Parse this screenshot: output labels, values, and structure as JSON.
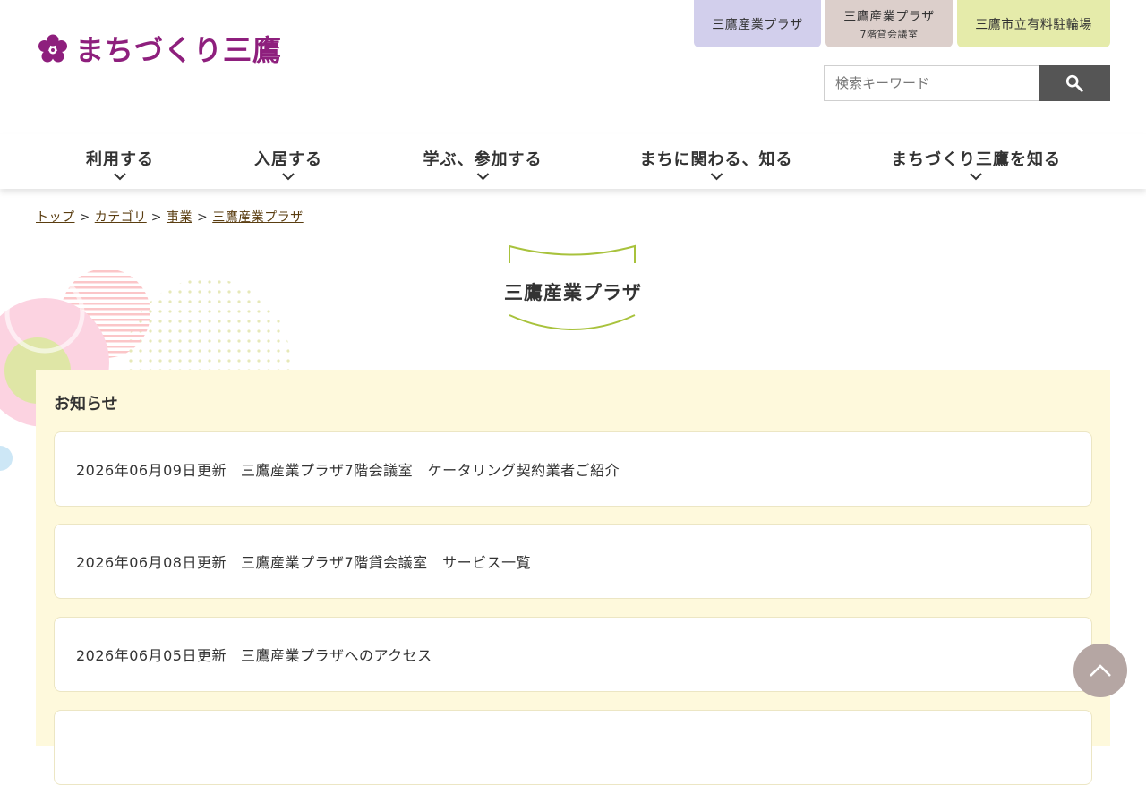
{
  "header": {
    "logo_text": "まちづくり三鷹",
    "top_tabs": [
      {
        "label": "三鷹産業プラザ",
        "sub": "",
        "color": "#d2cfec"
      },
      {
        "label": "三鷹産業プラザ",
        "sub": "7階貸会議室",
        "color": "#dccfcb"
      },
      {
        "label": "三鷹市立有料駐輪場",
        "sub": "",
        "color": "#e5ebaa"
      }
    ],
    "search": {
      "placeholder": "検索キーワード",
      "icon": "search-icon"
    }
  },
  "nav": {
    "items": [
      {
        "label": "利用する"
      },
      {
        "label": "入居する"
      },
      {
        "label": "学ぶ、参加する"
      },
      {
        "label": "まちに関わる、知る"
      },
      {
        "label": "まちづくり三鷹を知る"
      }
    ]
  },
  "breadcrumb": {
    "items": [
      "トップ",
      "カテゴリ",
      "事業",
      "三鷹産業プラザ"
    ],
    "separator": ">"
  },
  "page_title": "三鷹産業プラザ",
  "news": {
    "heading": "お知らせ",
    "items": [
      {
        "date": "2026年06月09日更新",
        "title": "三鷹産業プラザ7階会議室　ケータリング契約業者ご紹介"
      },
      {
        "date": "2026年06月08日更新",
        "title": "三鷹産業プラザ7階貸会議室　サービス一覧"
      },
      {
        "date": "2026年06月05日更新",
        "title": "三鷹産業プラザへのアクセス"
      }
    ]
  },
  "colors": {
    "brand": "#8e1f7d",
    "accent_green": "#a8c23c",
    "news_bg": "#fef9dc",
    "search_button": "#555555",
    "page_top_button": "#b5a6a3"
  }
}
